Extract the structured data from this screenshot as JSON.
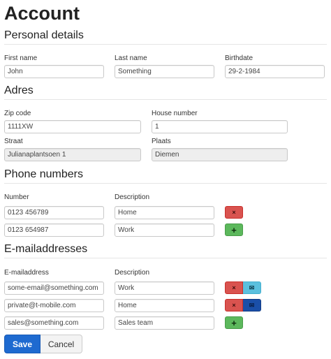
{
  "page": {
    "title": "Account"
  },
  "personal": {
    "heading": "Personal details",
    "first_name_label": "First name",
    "first_name_value": "John",
    "last_name_label": "Last name",
    "last_name_value": "Something",
    "birthdate_label": "Birthdate",
    "birthdate_value": "29-2-1984"
  },
  "address": {
    "heading": "Adres",
    "zip_label": "Zip code",
    "zip_value": "1111XW",
    "house_label": "House number",
    "house_value": "1",
    "street_label": "Straat",
    "street_value": "Julianaplantsoen 1",
    "city_label": "Plaats",
    "city_value": "Diemen"
  },
  "phones": {
    "heading": "Phone numbers",
    "number_label": "Number",
    "description_label": "Description",
    "rows": [
      {
        "number": "0123 456789",
        "description": "Home"
      },
      {
        "number": "0123 654987",
        "description": "Work"
      }
    ]
  },
  "emails": {
    "heading": "E-mailaddresses",
    "address_label": "E-mailaddress",
    "description_label": "Description",
    "rows": [
      {
        "address": "some-email@something.com",
        "description": "Work"
      },
      {
        "address": "private@t-mobile.com",
        "description": "Home"
      },
      {
        "address": "sales@something.com",
        "description": "Sales team"
      }
    ]
  },
  "icons": {
    "remove": "×",
    "add": "+",
    "mail": "✉"
  },
  "actions": {
    "save_label": "Save",
    "cancel_label": "Cancel"
  }
}
